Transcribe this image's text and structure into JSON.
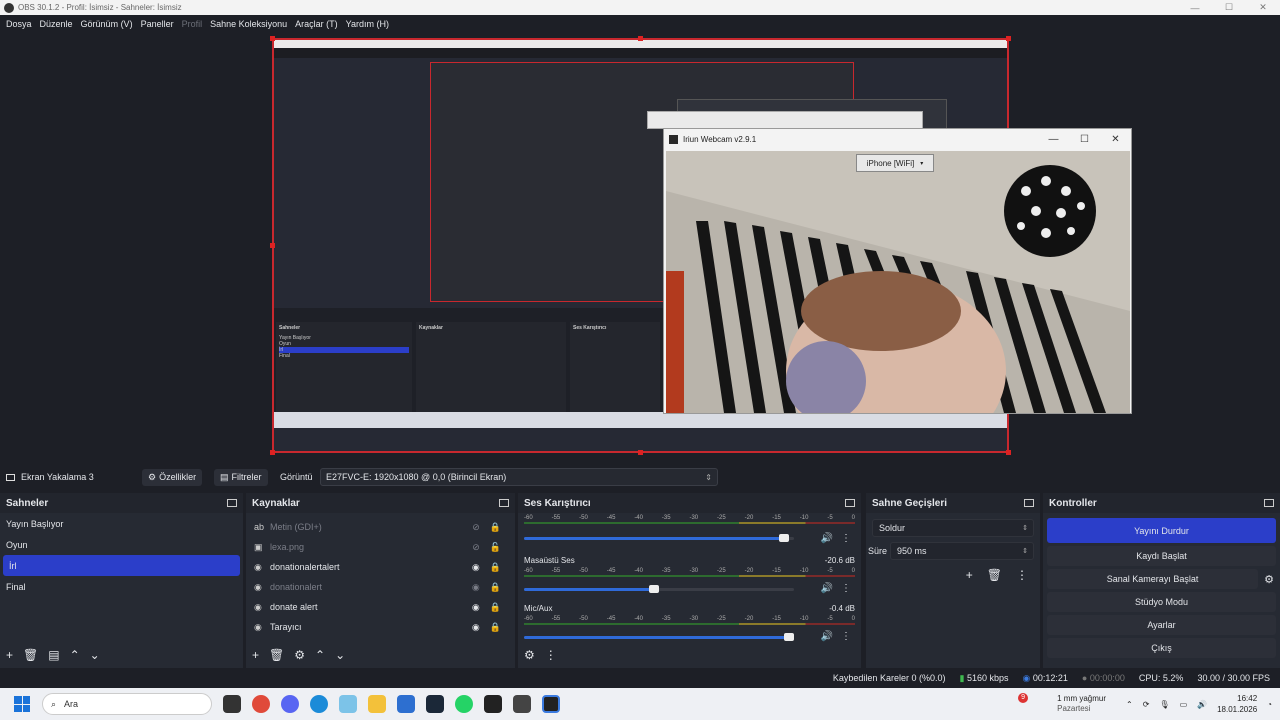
{
  "window": {
    "title": "OBS 30.1.2 - Profil: İsimsiz - Sahneler: İsimsiz"
  },
  "menu": [
    "Dosya",
    "Düzenle",
    "Görünüm (V)",
    "Paneller",
    "Profil",
    "Sahne Koleksiyonu",
    "Araçlar (T)",
    "Yardım (H)"
  ],
  "webcam_window": {
    "title": "Iriun Webcam v2.9.1",
    "device": "iPhone [WiFi]"
  },
  "source_bar": {
    "source_name": "Ekran Yakalama 3",
    "properties_label": "Özellikler",
    "filters_label": "Filtreler",
    "display_label": "Görüntü",
    "display_value": "E27FVC-E: 1920x1080 @ 0,0 (Birincil Ekran)"
  },
  "scenes": {
    "title": "Sahneler",
    "items": [
      "Yayın Başlıyor",
      "Oyun",
      "İrl",
      "Final"
    ],
    "selected": 2
  },
  "sources": {
    "title": "Kaynaklar",
    "items": [
      {
        "name": "Metin (GDI+)",
        "icon": "text-icon",
        "visible": false,
        "locked": true,
        "dim": true
      },
      {
        "name": "lexa.png",
        "icon": "image-icon",
        "visible": false,
        "locked": false,
        "dim": true
      },
      {
        "name": "donationalertalert",
        "icon": "browser-icon",
        "visible": true,
        "locked": true,
        "dim": false
      },
      {
        "name": "donationalert",
        "icon": "browser-icon",
        "visible": true,
        "locked": true,
        "dim": true
      },
      {
        "name": "donate alert",
        "icon": "browser-icon",
        "visible": true,
        "locked": true,
        "dim": false
      },
      {
        "name": "Tarayıcı",
        "icon": "browser-icon",
        "visible": true,
        "locked": true,
        "dim": false
      }
    ]
  },
  "mixer": {
    "title": "Ses Karıştırıcı",
    "ticks": [
      "-60",
      "-55",
      "-50",
      "-45",
      "-40",
      "-35",
      "-30",
      "-25",
      "-20",
      "-15",
      "-10",
      "-5",
      "0"
    ],
    "channels": [
      {
        "name": "",
        "db": "",
        "volume": 0.98
      },
      {
        "name": "Masaüstü Ses",
        "db": "-20.6 dB",
        "volume": 0.5
      },
      {
        "name": "Mic/Aux",
        "db": "-0.4 dB",
        "volume": 1.0
      }
    ]
  },
  "transitions": {
    "title": "Sahne Geçişleri",
    "type": "Soldur",
    "duration_label": "Süre",
    "duration_value": "950 ms"
  },
  "controls": {
    "title": "Kontroller",
    "stop_stream": "Yayını Durdur",
    "start_recording": "Kaydı Başlat",
    "start_virtual_cam": "Sanal Kamerayı Başlat",
    "studio_mode": "Stüdyo Modu",
    "settings": "Ayarlar",
    "exit": "Çıkış"
  },
  "status": {
    "dropped_frames": "Kaybedilen Kareler 0 (%0.0)",
    "bitrate": "5160 kbps",
    "stream_time": "00:12:21",
    "rec_time": "00:00:00",
    "cpu": "CPU: 5.2%",
    "fps": "30.00 / 30.00 FPS"
  },
  "taskbar": {
    "search_placeholder": "Ara",
    "weather_main": "1 mm yağmur",
    "weather_sub": "Pazartesi",
    "weather_badge": "9",
    "time": "16:42",
    "date": "18.01.2026"
  },
  "colors": {
    "accent": "#2b3ec9",
    "selection_border": "#c8282e",
    "panel": "#262a33",
    "background": "#1d1f26"
  }
}
